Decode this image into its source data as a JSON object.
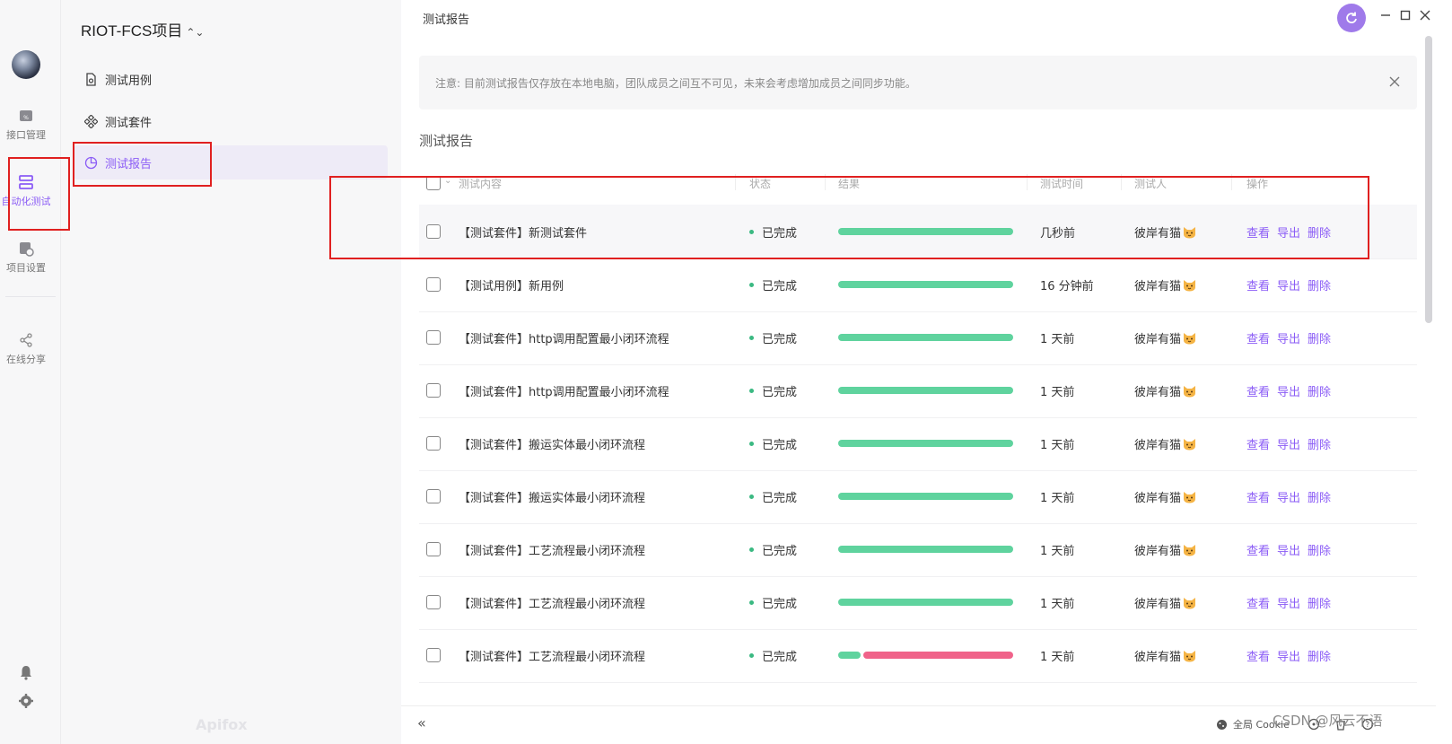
{
  "app": {
    "brand": "Apifox",
    "accent": "#8b5cf6",
    "watermark": "CSDN @风云不语"
  },
  "rail": {
    "items": [
      {
        "label": "接口管理",
        "icon": "api-icon",
        "active": false
      },
      {
        "label": "自动化测试",
        "icon": "automation-icon",
        "active": true
      },
      {
        "label": "项目设置",
        "icon": "project-settings-icon",
        "active": false
      },
      {
        "label": "在线分享",
        "icon": "share-icon",
        "active": false
      }
    ]
  },
  "sidebar": {
    "project_name": "RIOT-FCS项目",
    "items": [
      {
        "label": "测试用例",
        "icon": "file-icon"
      },
      {
        "label": "测试套件",
        "icon": "suite-icon"
      },
      {
        "label": "测试报告",
        "icon": "pie-chart-icon",
        "active": true
      }
    ]
  },
  "header": {
    "title": "测试报告"
  },
  "notice": {
    "text": "注意: 目前测试报告仅存放在本地电脑，团队成员之间互不可见，未来会考虑增加成员之间同步功能。"
  },
  "section": {
    "title": "测试报告"
  },
  "table": {
    "columns": [
      "测试内容",
      "状态",
      "结果",
      "测试时间",
      "测试人",
      "操作"
    ],
    "actions": {
      "view": "查看",
      "export": "导出",
      "delete": "删除"
    },
    "rows": [
      {
        "name": "【测试套件】新测试套件",
        "status": "已完成",
        "pass_ratio": 1.0,
        "time": "几秒前",
        "user": "彼岸有猫"
      },
      {
        "name": "【测试用例】新用例",
        "status": "已完成",
        "pass_ratio": 1.0,
        "time": "16 分钟前",
        "user": "彼岸有猫"
      },
      {
        "name": "【测试套件】http调用配置最小闭环流程",
        "status": "已完成",
        "pass_ratio": 1.0,
        "time": "1 天前",
        "user": "彼岸有猫"
      },
      {
        "name": "【测试套件】http调用配置最小闭环流程",
        "status": "已完成",
        "pass_ratio": 1.0,
        "time": "1 天前",
        "user": "彼岸有猫"
      },
      {
        "name": "【测试套件】搬运实体最小闭环流程",
        "status": "已完成",
        "pass_ratio": 1.0,
        "time": "1 天前",
        "user": "彼岸有猫"
      },
      {
        "name": "【测试套件】搬运实体最小闭环流程",
        "status": "已完成",
        "pass_ratio": 1.0,
        "time": "1 天前",
        "user": "彼岸有猫"
      },
      {
        "name": "【测试套件】工艺流程最小闭环流程",
        "status": "已完成",
        "pass_ratio": 1.0,
        "time": "1 天前",
        "user": "彼岸有猫"
      },
      {
        "name": "【测试套件】工艺流程最小闭环流程",
        "status": "已完成",
        "pass_ratio": 1.0,
        "time": "1 天前",
        "user": "彼岸有猫"
      },
      {
        "name": "【测试套件】工艺流程最小闭环流程",
        "status": "已完成",
        "pass_ratio": 0.14,
        "time": "1 天前",
        "user": "彼岸有猫"
      }
    ],
    "colors": {
      "pass": "#5fd39e",
      "fail": "#f0638a"
    }
  },
  "footer": {
    "collapse": "«",
    "cookie_label": "全局 Cookie"
  }
}
